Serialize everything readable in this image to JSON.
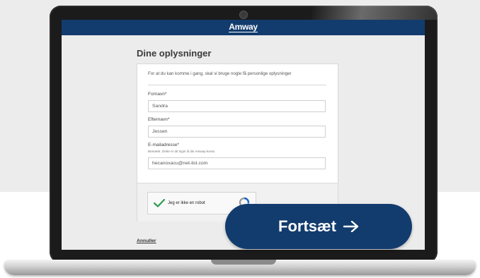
{
  "app": {
    "brand": "Amway"
  },
  "form": {
    "title": "Dine oplysninger",
    "intro": "For at du kan komme i gang, skal vi bruge nogle få personlige oplysninger",
    "first_name": {
      "label": "Fornavn*",
      "value": "Sandra"
    },
    "last_name": {
      "label": "Efternavn*",
      "value": "Jessen"
    },
    "email": {
      "label": "E-mailadresse*",
      "note": "Bemærk. Dette er dit login til din Amway-konto",
      "value": "hecanoxacu@net-list.com"
    },
    "captcha": {
      "label": "Jeg er ikke en robot",
      "checked": true
    },
    "cancel_label": "Annuller"
  },
  "cta": {
    "continue_label": "Fortsæt"
  },
  "colors": {
    "brand_blue": "#123c6e",
    "check_green": "#2e9c4e"
  },
  "icons": [
    "camera-icon",
    "check-icon",
    "recaptcha-icon",
    "arrow-right-icon"
  ]
}
